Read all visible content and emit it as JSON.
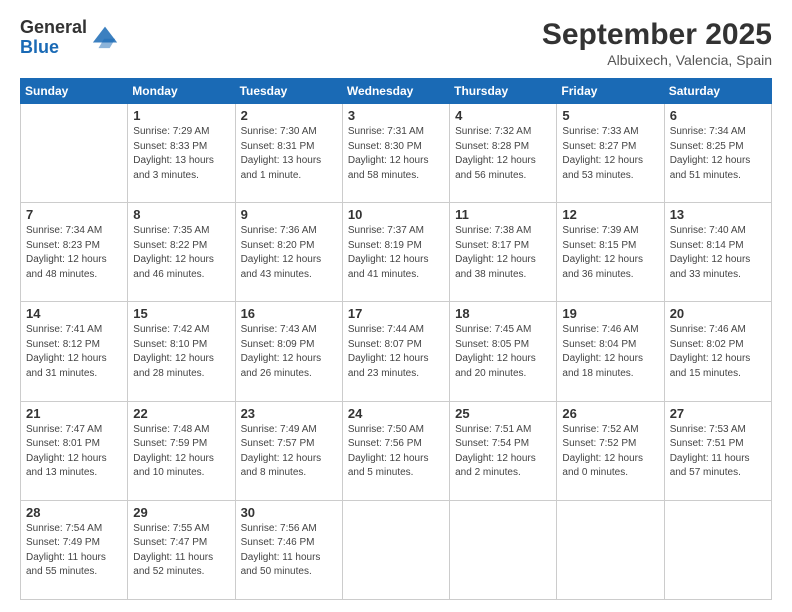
{
  "header": {
    "logo": {
      "line1": "General",
      "line2": "Blue"
    },
    "title": "September 2025",
    "location": "Albuixech, Valencia, Spain"
  },
  "weekdays": [
    "Sunday",
    "Monday",
    "Tuesday",
    "Wednesday",
    "Thursday",
    "Friday",
    "Saturday"
  ],
  "weeks": [
    [
      {
        "day": null
      },
      {
        "day": "1",
        "sunrise": "Sunrise: 7:29 AM",
        "sunset": "Sunset: 8:33 PM",
        "daylight": "Daylight: 13 hours and 3 minutes."
      },
      {
        "day": "2",
        "sunrise": "Sunrise: 7:30 AM",
        "sunset": "Sunset: 8:31 PM",
        "daylight": "Daylight: 13 hours and 1 minute."
      },
      {
        "day": "3",
        "sunrise": "Sunrise: 7:31 AM",
        "sunset": "Sunset: 8:30 PM",
        "daylight": "Daylight: 12 hours and 58 minutes."
      },
      {
        "day": "4",
        "sunrise": "Sunrise: 7:32 AM",
        "sunset": "Sunset: 8:28 PM",
        "daylight": "Daylight: 12 hours and 56 minutes."
      },
      {
        "day": "5",
        "sunrise": "Sunrise: 7:33 AM",
        "sunset": "Sunset: 8:27 PM",
        "daylight": "Daylight: 12 hours and 53 minutes."
      },
      {
        "day": "6",
        "sunrise": "Sunrise: 7:34 AM",
        "sunset": "Sunset: 8:25 PM",
        "daylight": "Daylight: 12 hours and 51 minutes."
      }
    ],
    [
      {
        "day": "7",
        "sunrise": "Sunrise: 7:34 AM",
        "sunset": "Sunset: 8:23 PM",
        "daylight": "Daylight: 12 hours and 48 minutes."
      },
      {
        "day": "8",
        "sunrise": "Sunrise: 7:35 AM",
        "sunset": "Sunset: 8:22 PM",
        "daylight": "Daylight: 12 hours and 46 minutes."
      },
      {
        "day": "9",
        "sunrise": "Sunrise: 7:36 AM",
        "sunset": "Sunset: 8:20 PM",
        "daylight": "Daylight: 12 hours and 43 minutes."
      },
      {
        "day": "10",
        "sunrise": "Sunrise: 7:37 AM",
        "sunset": "Sunset: 8:19 PM",
        "daylight": "Daylight: 12 hours and 41 minutes."
      },
      {
        "day": "11",
        "sunrise": "Sunrise: 7:38 AM",
        "sunset": "Sunset: 8:17 PM",
        "daylight": "Daylight: 12 hours and 38 minutes."
      },
      {
        "day": "12",
        "sunrise": "Sunrise: 7:39 AM",
        "sunset": "Sunset: 8:15 PM",
        "daylight": "Daylight: 12 hours and 36 minutes."
      },
      {
        "day": "13",
        "sunrise": "Sunrise: 7:40 AM",
        "sunset": "Sunset: 8:14 PM",
        "daylight": "Daylight: 12 hours and 33 minutes."
      }
    ],
    [
      {
        "day": "14",
        "sunrise": "Sunrise: 7:41 AM",
        "sunset": "Sunset: 8:12 PM",
        "daylight": "Daylight: 12 hours and 31 minutes."
      },
      {
        "day": "15",
        "sunrise": "Sunrise: 7:42 AM",
        "sunset": "Sunset: 8:10 PM",
        "daylight": "Daylight: 12 hours and 28 minutes."
      },
      {
        "day": "16",
        "sunrise": "Sunrise: 7:43 AM",
        "sunset": "Sunset: 8:09 PM",
        "daylight": "Daylight: 12 hours and 26 minutes."
      },
      {
        "day": "17",
        "sunrise": "Sunrise: 7:44 AM",
        "sunset": "Sunset: 8:07 PM",
        "daylight": "Daylight: 12 hours and 23 minutes."
      },
      {
        "day": "18",
        "sunrise": "Sunrise: 7:45 AM",
        "sunset": "Sunset: 8:05 PM",
        "daylight": "Daylight: 12 hours and 20 minutes."
      },
      {
        "day": "19",
        "sunrise": "Sunrise: 7:46 AM",
        "sunset": "Sunset: 8:04 PM",
        "daylight": "Daylight: 12 hours and 18 minutes."
      },
      {
        "day": "20",
        "sunrise": "Sunrise: 7:46 AM",
        "sunset": "Sunset: 8:02 PM",
        "daylight": "Daylight: 12 hours and 15 minutes."
      }
    ],
    [
      {
        "day": "21",
        "sunrise": "Sunrise: 7:47 AM",
        "sunset": "Sunset: 8:01 PM",
        "daylight": "Daylight: 12 hours and 13 minutes."
      },
      {
        "day": "22",
        "sunrise": "Sunrise: 7:48 AM",
        "sunset": "Sunset: 7:59 PM",
        "daylight": "Daylight: 12 hours and 10 minutes."
      },
      {
        "day": "23",
        "sunrise": "Sunrise: 7:49 AM",
        "sunset": "Sunset: 7:57 PM",
        "daylight": "Daylight: 12 hours and 8 minutes."
      },
      {
        "day": "24",
        "sunrise": "Sunrise: 7:50 AM",
        "sunset": "Sunset: 7:56 PM",
        "daylight": "Daylight: 12 hours and 5 minutes."
      },
      {
        "day": "25",
        "sunrise": "Sunrise: 7:51 AM",
        "sunset": "Sunset: 7:54 PM",
        "daylight": "Daylight: 12 hours and 2 minutes."
      },
      {
        "day": "26",
        "sunrise": "Sunrise: 7:52 AM",
        "sunset": "Sunset: 7:52 PM",
        "daylight": "Daylight: 12 hours and 0 minutes."
      },
      {
        "day": "27",
        "sunrise": "Sunrise: 7:53 AM",
        "sunset": "Sunset: 7:51 PM",
        "daylight": "Daylight: 11 hours and 57 minutes."
      }
    ],
    [
      {
        "day": "28",
        "sunrise": "Sunrise: 7:54 AM",
        "sunset": "Sunset: 7:49 PM",
        "daylight": "Daylight: 11 hours and 55 minutes."
      },
      {
        "day": "29",
        "sunrise": "Sunrise: 7:55 AM",
        "sunset": "Sunset: 7:47 PM",
        "daylight": "Daylight: 11 hours and 52 minutes."
      },
      {
        "day": "30",
        "sunrise": "Sunrise: 7:56 AM",
        "sunset": "Sunset: 7:46 PM",
        "daylight": "Daylight: 11 hours and 50 minutes."
      },
      {
        "day": null
      },
      {
        "day": null
      },
      {
        "day": null
      },
      {
        "day": null
      }
    ]
  ]
}
